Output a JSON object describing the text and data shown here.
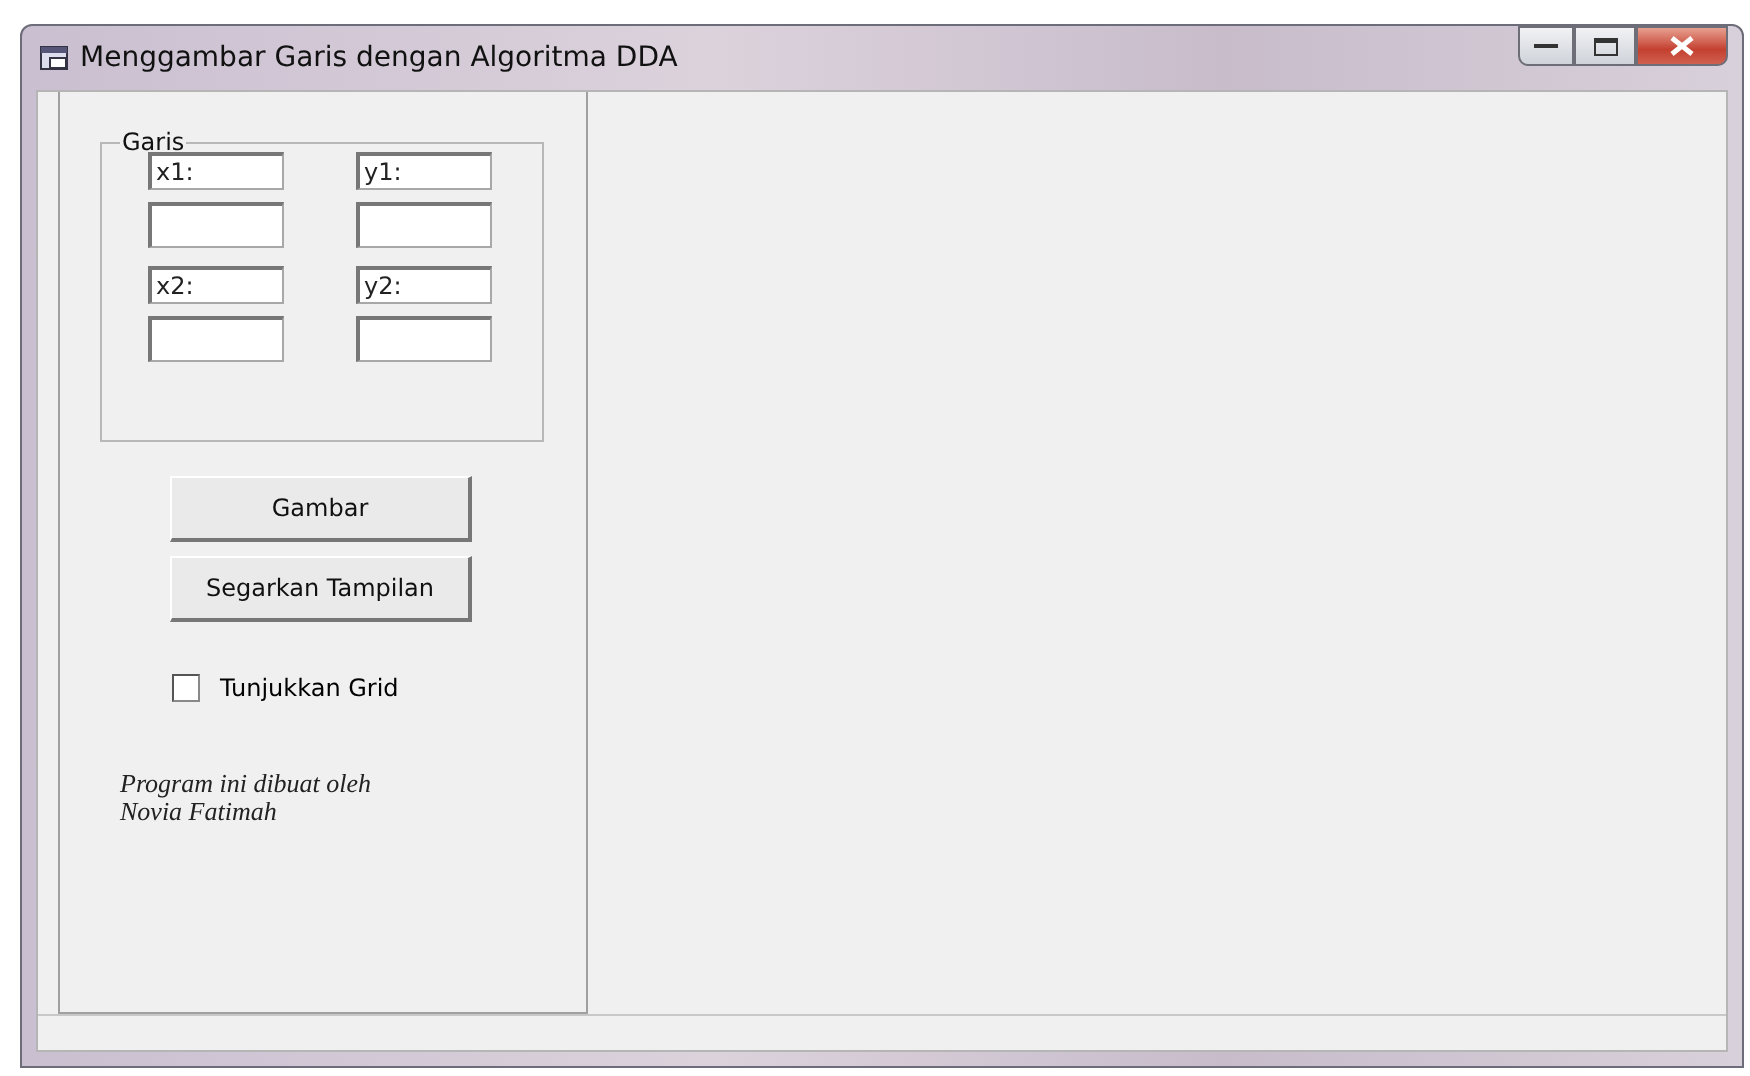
{
  "window": {
    "title": "Menggambar Garis dengan Algoritma DDA"
  },
  "group": {
    "title": "Garis",
    "coordinates": [
      {
        "label": "x1:"
      },
      {
        "label": "y1:"
      },
      {
        "label": "x2:"
      },
      {
        "label": "y2:"
      }
    ]
  },
  "buttons": [
    "Gambar",
    "Segarkan Tampilan"
  ],
  "grid_checkbox": {
    "label": "Tunjukkan Grid",
    "checked": false
  },
  "credit": "Program ini dibuat oleh Novia Fatimah"
}
